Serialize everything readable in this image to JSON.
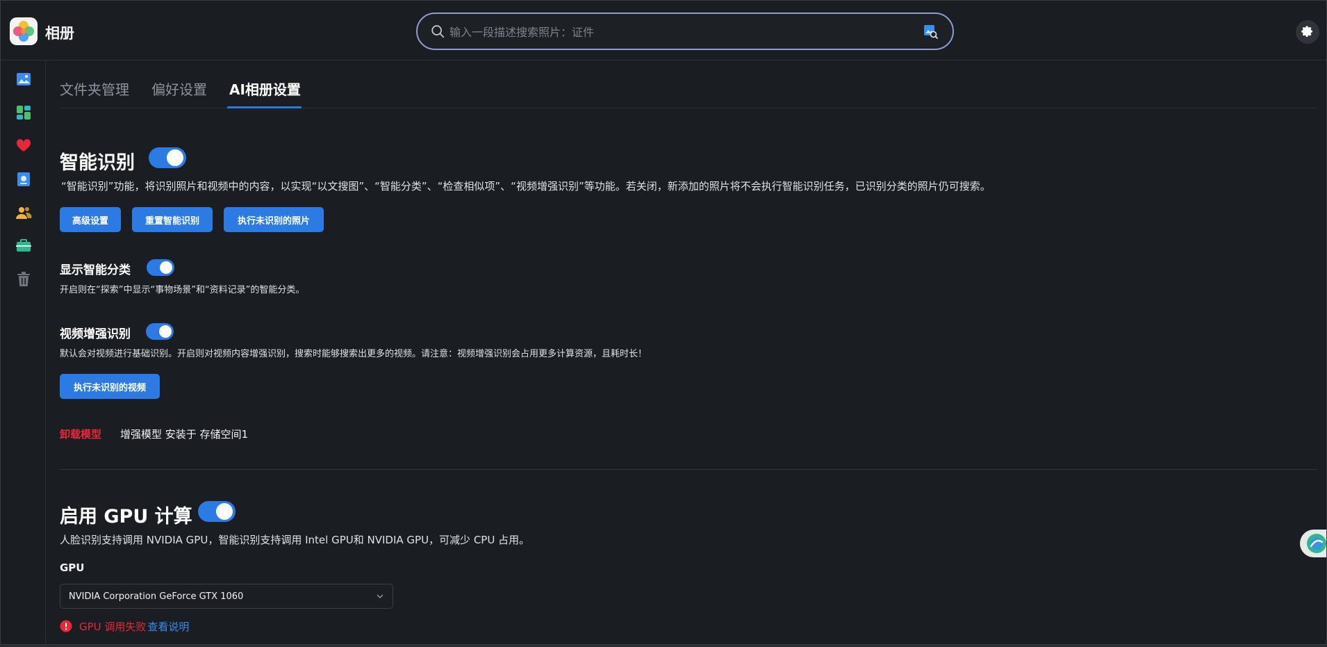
{
  "app": {
    "title": "相册"
  },
  "search": {
    "placeholder": "输入一段描述搜索照片：证件"
  },
  "tabs": [
    {
      "label": "文件夹管理"
    },
    {
      "label": "偏好设置"
    },
    {
      "label": "AI相册设置"
    }
  ],
  "smart_recognition": {
    "title": "智能识别",
    "enabled": true,
    "description": "“智能识别”功能，将识别照片和视频中的内容，以实现“以文搜图”、“智能分类”、“检查相似项”、“视频增强识别”等功能。若关闭，新添加的照片将不会执行智能识别任务，已识别分类的照片仍可搜索。",
    "buttons": {
      "advanced": "高级设置",
      "reset": "重置智能识别",
      "run_unrecognized_photos": "执行未识别的照片"
    }
  },
  "show_smart_category": {
    "title": "显示智能分类",
    "enabled": true,
    "description": "开启则在“探索”中显示“事物场景”和“资料记录”的智能分类。"
  },
  "video_enhanced": {
    "title": "视频增强识别",
    "enabled": true,
    "description": "默认会对视频进行基础识别。开启则对视频内容增强识别，搜索时能够搜索出更多的视频。请注意：视频增强识别会占用更多计算资源，且耗时长！",
    "run_button": "执行未识别的视频",
    "uninstall_label": "卸载模型",
    "model_info": "增强模型 安装于 存储空间1"
  },
  "gpu": {
    "title": "启用 GPU 计算",
    "enabled": true,
    "description": "人脸识别支持调用 NVIDIA GPU，智能识别支持调用 Intel GPU和 NVIDIA GPU，可减少 CPU 占用。",
    "field_label": "GPU",
    "selected": "NVIDIA Corporation GeForce GTX 1060",
    "error_text": "GPU 调用失败",
    "help_link": "查看说明"
  },
  "colors": {
    "accent": "#2c7be5",
    "danger": "#e8283a",
    "background": "#1a1d21"
  },
  "sidebar_icons": [
    "photos-icon",
    "albums-icon",
    "favorites-icon",
    "shared-album-icon",
    "people-icon",
    "travel-icon",
    "trash-icon"
  ]
}
